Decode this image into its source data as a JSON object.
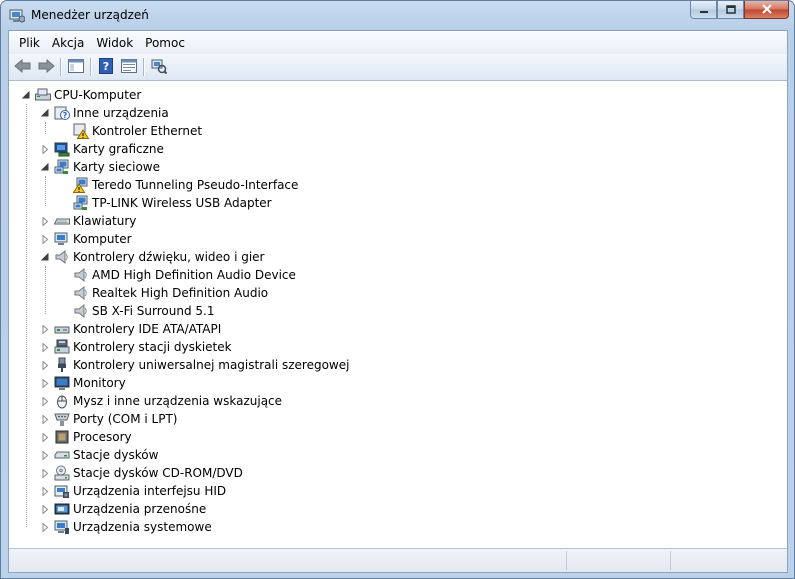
{
  "window": {
    "title": "Menedżer urządzeń"
  },
  "menu": [
    "Plik",
    "Akcja",
    "Widok",
    "Pomoc"
  ],
  "toolbar": {
    "buttons": [
      "back-arrow-icon",
      "forward-arrow-icon",
      "show-hide-console-tree-icon",
      "help-icon",
      "properties-icon",
      "scan-hardware-icon"
    ]
  },
  "tree": {
    "root": "CPU-Komputer",
    "items": [
      {
        "label": "Inne urządzenia",
        "expanded": true,
        "icon": "unknown-device-icon",
        "children": [
          {
            "label": "Kontroler Ethernet",
            "icon": "warning-device-icon"
          }
        ]
      },
      {
        "label": "Karty graficzne",
        "expanded": false,
        "icon": "display-adapter-icon"
      },
      {
        "label": "Karty sieciowe",
        "expanded": true,
        "icon": "network-adapter-icon",
        "children": [
          {
            "label": "Teredo Tunneling Pseudo-Interface",
            "icon": "network-warning-icon"
          },
          {
            "label": "TP-LINK Wireless USB Adapter",
            "icon": "network-adapter-icon"
          }
        ]
      },
      {
        "label": "Klawiatury",
        "expanded": false,
        "icon": "keyboard-icon"
      },
      {
        "label": "Komputer",
        "expanded": false,
        "icon": "computer-icon"
      },
      {
        "label": "Kontrolery dźwięku, wideo i gier",
        "expanded": true,
        "icon": "speaker-icon",
        "children": [
          {
            "label": "AMD High Definition Audio Device",
            "icon": "speaker-icon"
          },
          {
            "label": "Realtek High Definition Audio",
            "icon": "speaker-icon"
          },
          {
            "label": "SB X-Fi Surround 5.1",
            "icon": "speaker-icon"
          }
        ]
      },
      {
        "label": "Kontrolery IDE ATA/ATAPI",
        "expanded": false,
        "icon": "ide-controller-icon"
      },
      {
        "label": "Kontrolery stacji dyskietek",
        "expanded": false,
        "icon": "floppy-controller-icon"
      },
      {
        "label": "Kontrolery uniwersalnej magistrali szeregowej",
        "expanded": false,
        "icon": "usb-icon"
      },
      {
        "label": "Monitory",
        "expanded": false,
        "icon": "monitor-icon"
      },
      {
        "label": "Mysz i inne urządzenia wskazujące",
        "expanded": false,
        "icon": "mouse-icon"
      },
      {
        "label": "Porty (COM i LPT)",
        "expanded": false,
        "icon": "port-icon"
      },
      {
        "label": "Procesory",
        "expanded": false,
        "icon": "processor-icon"
      },
      {
        "label": "Stacje dysków",
        "expanded": false,
        "icon": "disk-drive-icon"
      },
      {
        "label": "Stacje dysków CD-ROM/DVD",
        "expanded": false,
        "icon": "cdrom-icon"
      },
      {
        "label": "Urządzenia interfejsu HID",
        "expanded": false,
        "icon": "hid-icon"
      },
      {
        "label": "Urządzenia przenośne",
        "expanded": false,
        "icon": "portable-device-icon"
      },
      {
        "label": "Urządzenia systemowe",
        "expanded": false,
        "icon": "system-device-icon"
      }
    ]
  }
}
